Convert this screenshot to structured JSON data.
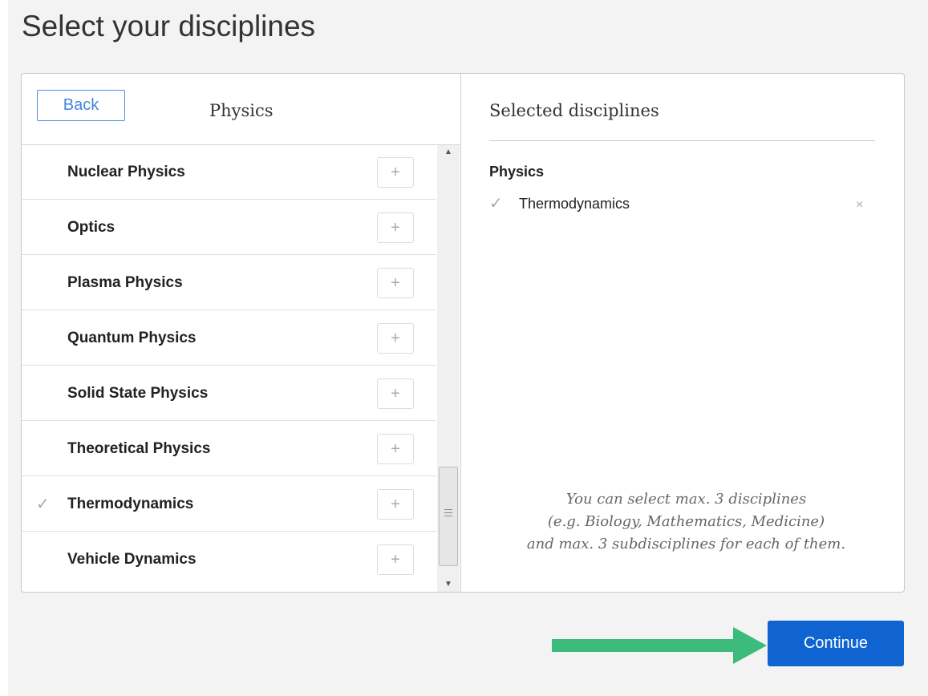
{
  "page": {
    "title": "Select your disciplines"
  },
  "left_panel": {
    "back_label": "Back",
    "title": "Physics",
    "items": [
      {
        "label": "Nuclear Physics",
        "selected": false,
        "add": "+"
      },
      {
        "label": "Optics",
        "selected": false,
        "add": "+"
      },
      {
        "label": "Plasma Physics",
        "selected": false,
        "add": "+"
      },
      {
        "label": "Quantum Physics",
        "selected": false,
        "add": "+"
      },
      {
        "label": "Solid State Physics",
        "selected": false,
        "add": "+"
      },
      {
        "label": "Theoretical Physics",
        "selected": false,
        "add": "+"
      },
      {
        "label": "Thermodynamics",
        "selected": true,
        "add": "+"
      },
      {
        "label": "Vehicle Dynamics",
        "selected": false,
        "add": "+"
      }
    ],
    "check_glyph": "✓",
    "scroll_up_glyph": "▲",
    "scroll_down_glyph": "▼"
  },
  "right_panel": {
    "title": "Selected disciplines",
    "groups": [
      {
        "heading": "Physics",
        "items": [
          {
            "label": "Thermodynamics",
            "remove": "×"
          }
        ]
      }
    ],
    "note_lines": [
      "You can select max. 3 disciplines",
      "(e.g. Biology, Mathematics, Medicine)",
      "and max. 3 subdisciplines for each of them."
    ]
  },
  "footer": {
    "continue_label": "Continue"
  },
  "colors": {
    "accent": "#0f64d2",
    "back_border": "#4a90e2",
    "arrow": "#3dbb7c",
    "page_background": "#f3f3f3"
  },
  "icons": {
    "add": "plus-icon",
    "check": "check-icon",
    "remove": "close-icon",
    "arrow": "arrow-right-icon"
  }
}
